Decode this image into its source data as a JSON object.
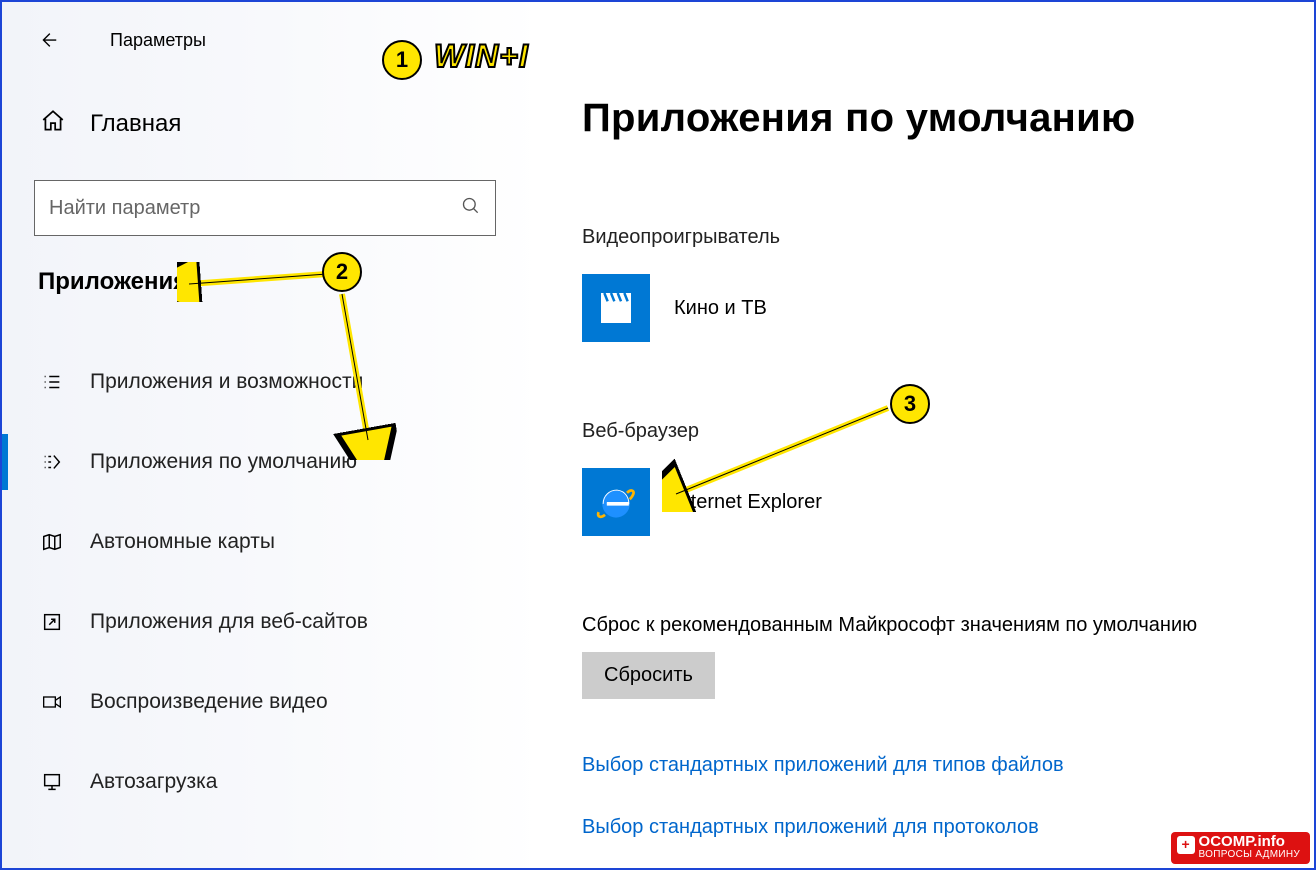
{
  "header": {
    "title": "Параметры"
  },
  "home": {
    "label": "Главная"
  },
  "search": {
    "placeholder": "Найти параметр"
  },
  "section": {
    "title": "Приложения"
  },
  "nav": [
    {
      "id": "apps-features",
      "label": "Приложения и возможности"
    },
    {
      "id": "default-apps",
      "label": "Приложения по умолчанию",
      "active": true
    },
    {
      "id": "offline-maps",
      "label": "Автономные карты"
    },
    {
      "id": "websites",
      "label": "Приложения для веб-сайтов"
    },
    {
      "id": "video-playback",
      "label": "Воспроизведение видео"
    },
    {
      "id": "startup",
      "label": "Автозагрузка"
    }
  ],
  "page": {
    "title": "Приложения по умолчанию",
    "video_label": "Видеопроигрыватель",
    "video_app": "Кино и ТВ",
    "browser_label": "Веб-браузер",
    "browser_app": "Internet Explorer",
    "reset_text": "Сброс к рекомендованным Майкрософт значениям по умолчанию",
    "reset_button": "Сбросить",
    "link_filetypes": "Выбор стандартных приложений для типов файлов",
    "link_protocols": "Выбор стандартных приложений для протоколов"
  },
  "annotations": {
    "c1": "1",
    "c2": "2",
    "c3": "3",
    "hotkey": "WIN+I"
  },
  "watermark": {
    "line1": "OCOMP.info",
    "line2": "ВОПРОСЫ АДМИНУ"
  }
}
